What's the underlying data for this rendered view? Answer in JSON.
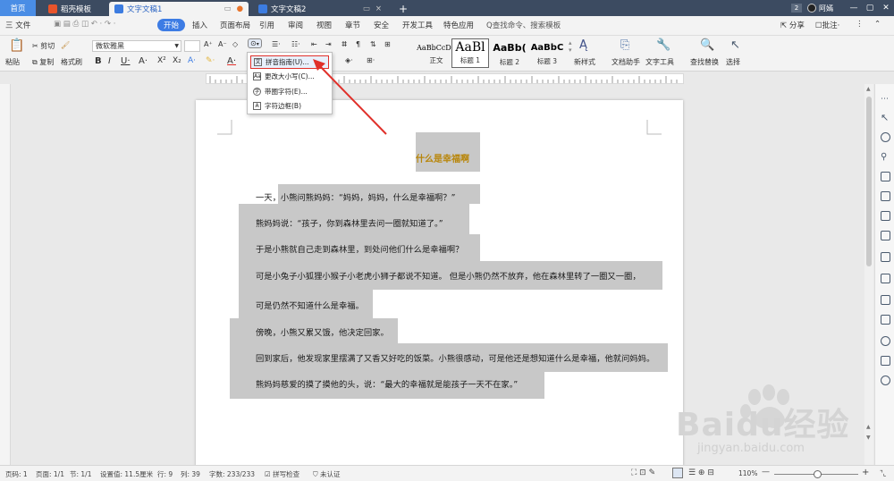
{
  "titlebar": {
    "tabs": [
      {
        "label": "首页"
      },
      {
        "label": "稻壳模板"
      },
      {
        "label": "文字文稿1"
      },
      {
        "label": "文字文稿2"
      }
    ],
    "badge": "2",
    "user": "阿嫣"
  },
  "menubar": {
    "items": [
      "三 文件",
      "开始",
      "插入",
      "页面布局",
      "引用",
      "审阅",
      "视图",
      "章节",
      "安全",
      "开发工具",
      "特色应用"
    ],
    "search_placeholder": "Q查找命令、搜索模板",
    "share": "分享",
    "comment": "批注"
  },
  "ribbon": {
    "paste": "粘贴",
    "cut": "剪切",
    "copy": "复制",
    "format_painter": "格式刷",
    "font_name": "微软雅黑",
    "font_size": "",
    "styles": [
      {
        "preview": "AaBbCcDd",
        "label": "正文"
      },
      {
        "preview": "AaBl",
        "label": "标题 1"
      },
      {
        "preview": "AaBb(",
        "label": "标题 2"
      },
      {
        "preview": "AaBbC",
        "label": "标题 3"
      }
    ],
    "new_style": "新样式",
    "doc_helper": "文档助手",
    "text_tools": "文字工具",
    "find_replace": "查找替换",
    "select": "选择"
  },
  "dropdown": {
    "items": [
      {
        "label": "拼音指南(U)...",
        "icon": "pinyin-icon"
      },
      {
        "label": "更改大小写(C)...",
        "icon": "case-icon"
      },
      {
        "label": "带圈字符(E)...",
        "icon": "enclosed-char-icon"
      },
      {
        "label": "字符边框(B)",
        "icon": "char-border-icon"
      }
    ]
  },
  "document": {
    "title": "什么是幸福啊",
    "lines": [
      "一天，小熊问熊妈妈：“妈妈，妈妈，什么是幸福啊？”",
      "熊妈妈说：“孩子，你到森林里去问一圈就知道了。”",
      "于是小熊就自己走到森林里，到处问他们什么是幸福啊？",
      "可是小兔子小狐狸小猴子小老虎小狮子都说不知道。 但是小熊仍然不放弃，他在森林里转了一圈又一圈，",
      "可是仍然不知道什么是幸福。",
      "傍晚，小熊又累又饿，他决定回家。",
      "回到家后，他发现家里摆满了又香又好吃的饭菜。小熊很感动，可是他还是想知道什么是幸福，他就问妈妈。",
      "熊妈妈慈爱的摸了摸他的头，说：“最大的幸福就是能孩子一天不在家。”"
    ]
  },
  "statusbar": {
    "page_num": "页码: 1",
    "page_count": "页面: 1/1",
    "section": "节: 1/1",
    "position": "设置值: 11.5厘米",
    "row": "行: 9",
    "col": "列: 39",
    "word_count": "字数: 233/233",
    "spell_check": "拼写检查",
    "auth": "未认证",
    "zoom": "110%"
  },
  "watermark": {
    "brand": "Baidu经验",
    "url": "jingyan.baidu.com"
  },
  "colors": {
    "title_gold": "#b8860b",
    "highlight": "#c8c8c8",
    "accent_blue": "#3d7ce4",
    "annotation_red": "#e0302a",
    "titlebar_bg": "#3c4b61"
  }
}
